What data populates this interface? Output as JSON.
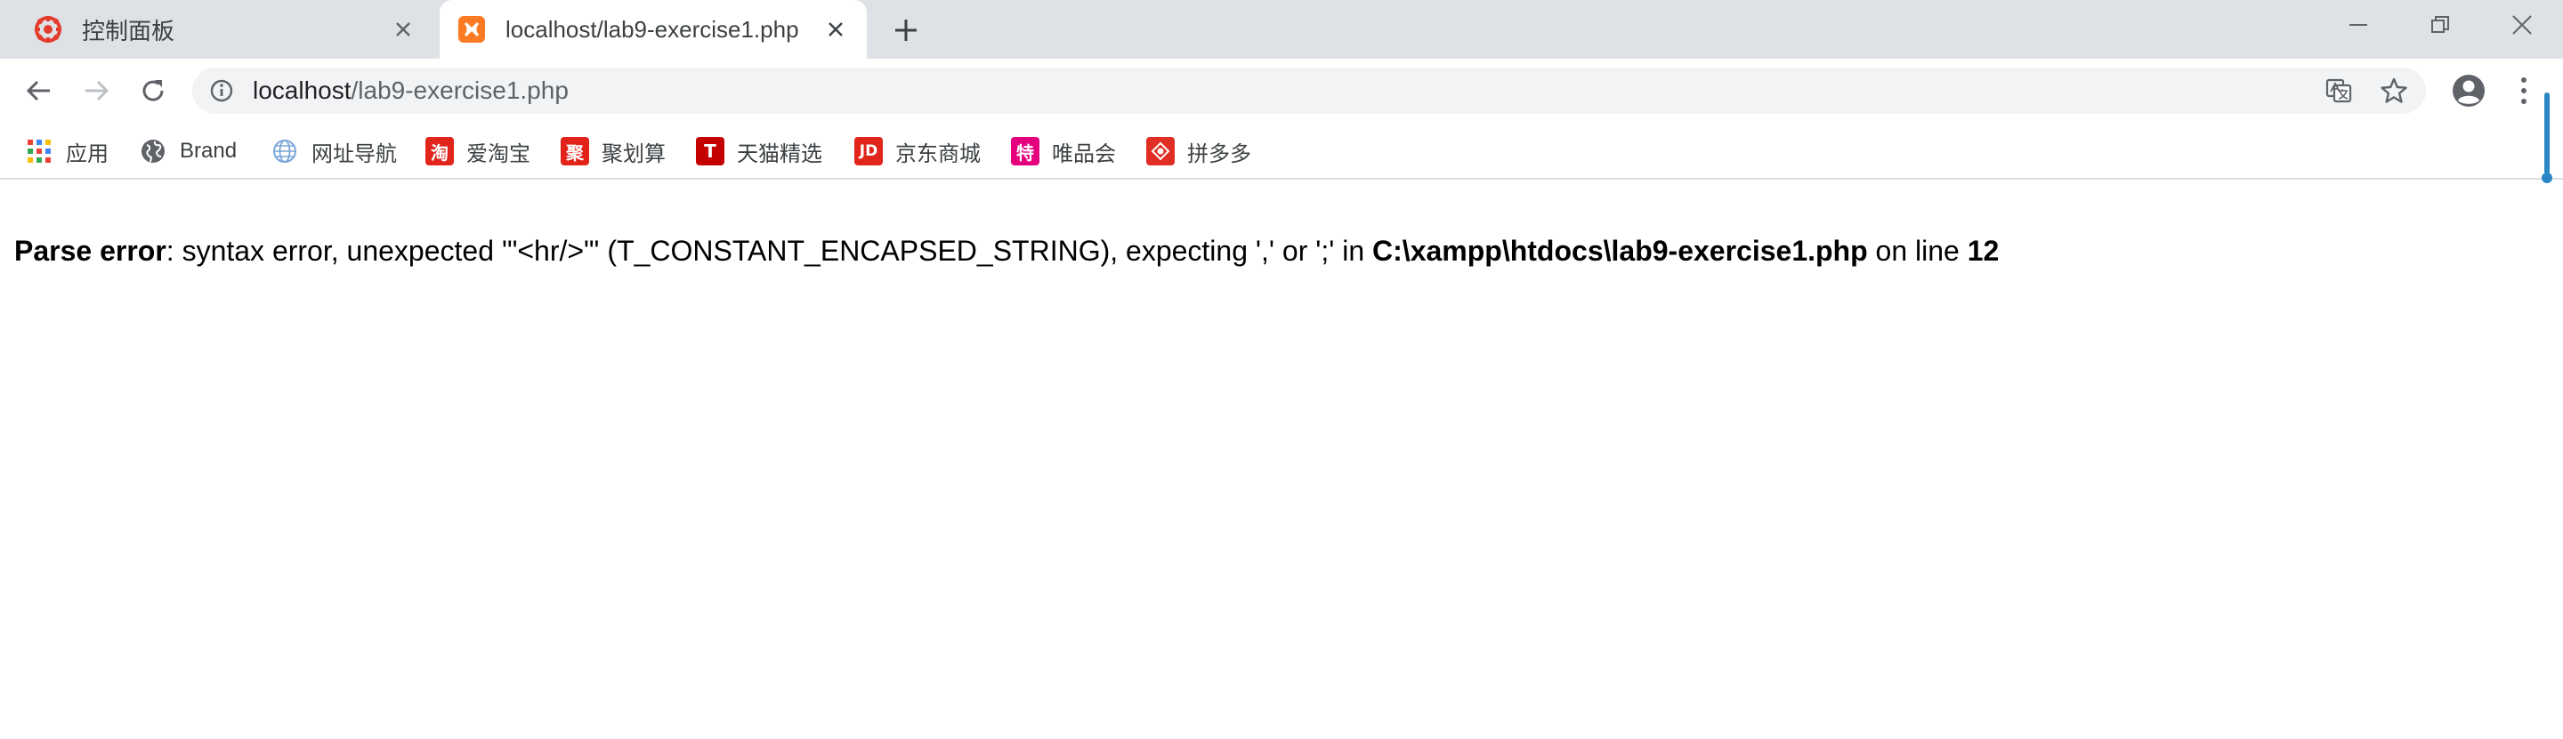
{
  "tabs": [
    {
      "title": "控制面板",
      "active": false,
      "favicon": "xampp-control-icon"
    },
    {
      "title": "localhost/lab9-exercise1.php",
      "active": true,
      "favicon": "xampp-icon"
    }
  ],
  "address_bar": {
    "host": "localhost",
    "path": "/lab9-exercise1.php"
  },
  "bookmarks": [
    {
      "label": "应用",
      "icon": "apps-grid-icon"
    },
    {
      "label": "Brand",
      "icon": "globe-icon"
    },
    {
      "label": "网址导航",
      "icon": "globe-outline-icon"
    },
    {
      "label": "爱淘宝",
      "icon": "taobao-icon",
      "glyph": "淘",
      "color": "#e1251b"
    },
    {
      "label": "聚划算",
      "icon": "juhuasuan-icon",
      "glyph": "聚",
      "color": "#e2231a"
    },
    {
      "label": "天猫精选",
      "icon": "tmall-icon",
      "glyph": "T",
      "color": "#c40000"
    },
    {
      "label": "京东商城",
      "icon": "jd-icon",
      "glyph": "JD",
      "color": "#e1251b"
    },
    {
      "label": "唯品会",
      "icon": "vip-icon",
      "glyph": "特",
      "color": "#e5007e"
    },
    {
      "label": "拼多多",
      "icon": "pinduoduo-icon",
      "color": "#e02e24"
    }
  ],
  "error": {
    "label": "Parse error",
    "message": ": syntax error, unexpected '\"<hr/>\"' (T_CONSTANT_ENCAPSED_STRING), expecting ',' or ';' in ",
    "file": "C:\\xampp\\htdocs\\lab9-exercise1.php",
    "line_prefix": " on line ",
    "line": "12"
  }
}
